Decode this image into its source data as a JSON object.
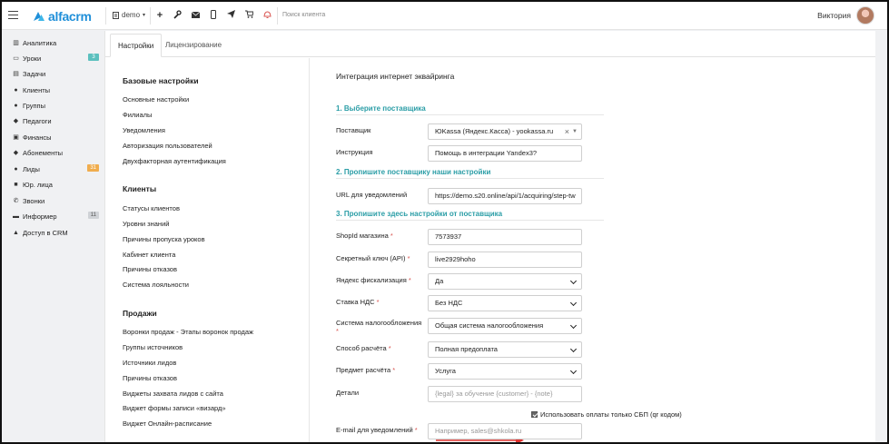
{
  "header": {
    "logo_text": "alfacrm",
    "branch_name": "demo",
    "search_placeholder": "Поиск клиента",
    "user_name": "Виктория",
    "icons": [
      "plus-icon",
      "wrench-icon",
      "mail-icon",
      "phone-icon",
      "send-icon",
      "cart-icon",
      "bell-icon"
    ]
  },
  "sidebar": {
    "items": [
      {
        "label": "Аналитика",
        "icon": "bar-chart-icon",
        "badge": ""
      },
      {
        "label": "Уроки",
        "icon": "calendar-icon",
        "badge": "3",
        "badge_color": "#5bc0be"
      },
      {
        "label": "Задачи",
        "icon": "tasks-icon",
        "badge": ""
      },
      {
        "label": "Клиенты",
        "icon": "user-icon",
        "badge": ""
      },
      {
        "label": "Группы",
        "icon": "users-icon",
        "badge": ""
      },
      {
        "label": "Педагоги",
        "icon": "graduation-cap-icon",
        "badge": ""
      },
      {
        "label": "Финансы",
        "icon": "money-icon",
        "badge": ""
      },
      {
        "label": "Абонементы",
        "icon": "tag-icon",
        "badge": ""
      },
      {
        "label": "Лиды",
        "icon": "user-plus-icon",
        "badge": "31",
        "badge_color": "#f0ad4e"
      },
      {
        "label": "Юр. лица",
        "icon": "briefcase-icon",
        "badge": ""
      },
      {
        "label": "Звонки",
        "icon": "phone-icon",
        "badge": ""
      },
      {
        "label": "Информер",
        "icon": "inbox-icon",
        "badge": "11",
        "badge_color": "#cfd2d6"
      },
      {
        "label": "Доступ в CRM",
        "icon": "lock-icon",
        "badge": ""
      }
    ]
  },
  "tabs": [
    {
      "label": "Настройки",
      "active": true
    },
    {
      "label": "Лицензирование",
      "active": false
    }
  ],
  "settings_nav": {
    "sections": [
      {
        "title": "Базовые настройки",
        "links": [
          "Основные настройки",
          "Филиалы",
          "Уведомления",
          "Авторизация пользователей",
          "Двухфакторная аутентификация"
        ]
      },
      {
        "title": "Клиенты",
        "links": [
          "Статусы клиентов",
          "Уровни знаний",
          "Причины пропуска уроков",
          "Кабинет клиента",
          "Причины отказов",
          "Система лояльности"
        ]
      },
      {
        "title": "Продажи",
        "links": [
          "Воронки продаж - Этапы воронок продаж",
          "Группы источников",
          "Источники лидов",
          "Причины отказов",
          "Виджеты захвата лидов с сайта",
          "Виджет формы записи «визард»",
          "Виджет Онлайн-расписание"
        ]
      }
    ]
  },
  "form": {
    "title": "Интеграция интернет эквайринга",
    "step1": "1. Выберите поставщика",
    "step2": "2. Пропишите поставщику наши настройки",
    "step3": "3. Пропишите здесь настройки от поставщика",
    "provider_label": "Поставщик",
    "provider_value": "ЮKassa (Яндекс.Касса) - yookassa.ru",
    "instruction_label": "Инструкция",
    "instruction_value": "Помощь в интеграции Yandex3?",
    "url_label": "URL для уведомлений",
    "url_value": "https://demo.s20.online/api/1/acquiring/step-tw",
    "shop_id_label": "ShopId магазина",
    "shop_id_value": "7573937",
    "secret_label": "Секретный ключ (API)",
    "secret_value": "live2929hoho",
    "fiscal_label": "Яндекс фискализация",
    "fiscal_value": "Да",
    "vat_label": "Ставка НДС",
    "vat_value": "Без НДС",
    "tax_label": "Система налогообложения",
    "tax_value": "Общая система налогообложения",
    "pay_method_label": "Способ расчёта",
    "pay_method_value": "Полная предоплата",
    "subject_label": "Предмет расчёта",
    "subject_value": "Услуга",
    "details_label": "Детали",
    "details_placeholder": "{legal} за обучение {customer} - {note}",
    "sbp_label": "Использовать оплаты только СБП (qr кодом)",
    "sbp_checked": true,
    "email_label": "E-mail для уведомлений",
    "email_placeholder": "Например, sales@shkola.ru",
    "required_mark": "*"
  }
}
